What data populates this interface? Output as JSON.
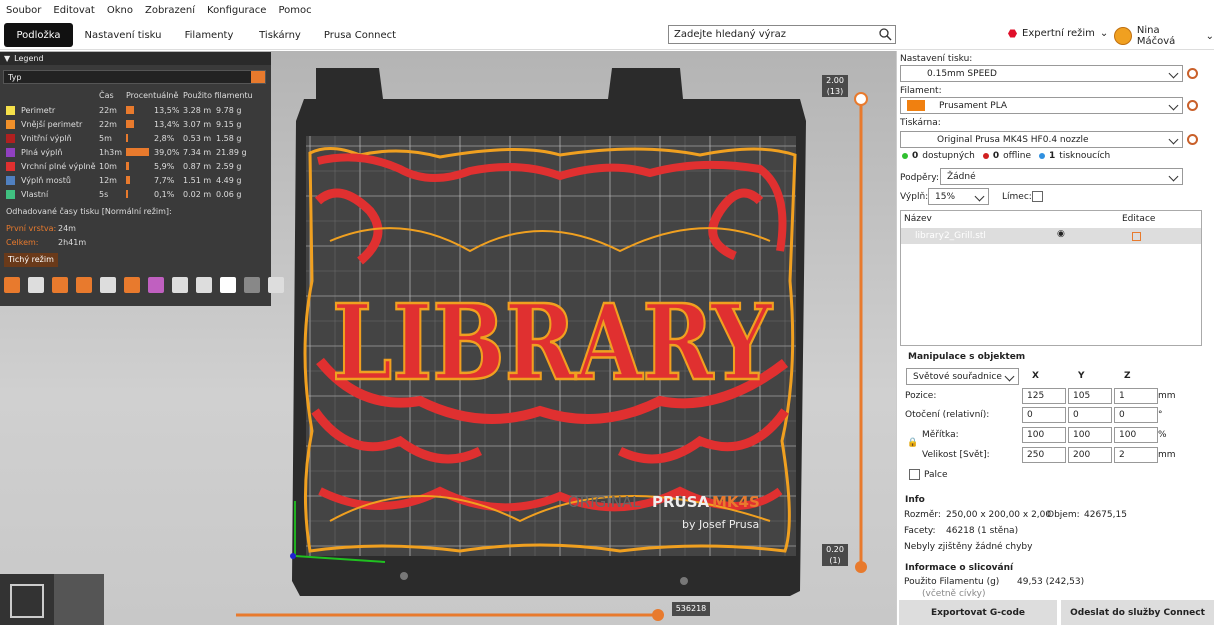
{
  "menu": [
    "Soubor",
    "Editovat",
    "Okno",
    "Zobrazení",
    "Konfigurace",
    "Pomoc"
  ],
  "tabs": [
    "Podložka",
    "Nastavení tisku",
    "Filamenty",
    "Tiskárny",
    "Prusa Connect"
  ],
  "search": {
    "placeholder": "Zadejte hledaný výraz"
  },
  "mode": "Expertní režim",
  "user": "Nina Máčová",
  "legend": {
    "title": "Legend",
    "type": "Typ",
    "headers": [
      "Čas",
      "Procentuálně",
      "Použito filamentu"
    ],
    "rows": [
      {
        "name": "Perimetr",
        "time": "22m",
        "pct": "13,5%",
        "len": "3.28 m",
        "wt": "9.78 g",
        "color": "#f5e04a",
        "frac": 0.135
      },
      {
        "name": "Vnější perimetr",
        "time": "22m",
        "pct": "13,4%",
        "len": "3.07 m",
        "wt": "9.15 g",
        "color": "#f0902a",
        "frac": 0.134
      },
      {
        "name": "Vnitřní výplň",
        "time": "5m",
        "pct": "2,8%",
        "len": "0.53 m",
        "wt": "1.58 g",
        "color": "#b02020",
        "frac": 0.028
      },
      {
        "name": "Plná výplň",
        "time": "1h3m",
        "pct": "39,0%",
        "len": "7.34 m",
        "wt": "21.89 g",
        "color": "#9040c0",
        "frac": 0.39
      },
      {
        "name": "Vrchní plné výplně",
        "time": "10m",
        "pct": "5,9%",
        "len": "0.87 m",
        "wt": "2.59 g",
        "color": "#e03030",
        "frac": 0.059
      },
      {
        "name": "Výplň mostů",
        "time": "12m",
        "pct": "7,7%",
        "len": "1.51 m",
        "wt": "4.49 g",
        "color": "#5080c0",
        "frac": 0.077
      },
      {
        "name": "Vlastní",
        "time": "5s",
        "pct": "0,1%",
        "len": "0.02 m",
        "wt": "0.06 g",
        "color": "#40c080",
        "frac": 0.001
      }
    ],
    "est_title": "Odhadované časy tisku [Normální režim]:",
    "first_layer_label": "První vrstva:",
    "first_layer": "24m",
    "total_label": "Celkem:",
    "total": "2h41m",
    "quiet_btn": "Tichý režim"
  },
  "slider": {
    "top_h": "2.00",
    "top_n": "(13)",
    "bot_h": "0.20",
    "bot_n": "(1)",
    "horiz": "536218"
  },
  "bed_text": {
    "brand1": "ORIGINAL",
    "brand2": "PRUSA",
    "model": "MK4S",
    "by": "by Josef Prusa",
    "logo": "LIBRARY"
  },
  "right": {
    "print_settings_label": "Nastavení tisku:",
    "print_settings": "0.15mm SPEED",
    "filament_label": "Filament:",
    "filament": "Prusament PLA",
    "filament_color": "#f08010",
    "printer_label": "Tiskárna:",
    "printer": "Original Prusa MK4S HF0.4 nozzle",
    "status": {
      "avail": "0",
      "avail_l": "dostupných",
      "off": "0",
      "off_l": "offline",
      "print": "1",
      "print_l": "tisknoucích"
    },
    "supports_label": "Podpěry:",
    "supports": "Žádné",
    "infill_label": "Výplň:",
    "infill": "15%",
    "brim_label": "Límec:",
    "list_name": "Název",
    "list_edit": "Editace",
    "object": "library2_Grill.stl",
    "manip_title": "Manipulace s objektem",
    "coords": "Světové souřadnice",
    "axes": [
      "X",
      "Y",
      "Z"
    ],
    "pos_label": "Pozice:",
    "pos": [
      "125",
      "105",
      "1"
    ],
    "pos_unit": "mm",
    "rot_label": "Otočení (relativní):",
    "rot": [
      "0",
      "0",
      "0"
    ],
    "rot_unit": "°",
    "scale_label": "Měřítka:",
    "scale": [
      "100",
      "100",
      "100"
    ],
    "scale_unit": "%",
    "size_label": "Velikost [Svět]:",
    "size": [
      "250",
      "200",
      "2"
    ],
    "size_unit": "mm",
    "inches": "Palce",
    "info_title": "Info",
    "size_info_l": "Rozměr:",
    "size_info": "250,00 x 200,00 x 2,00",
    "vol_l": "Objem:",
    "vol": "42675,15",
    "facets_l": "Facety:",
    "facets": "46218 (1 stěna)",
    "errors": "Nebyly zjištěny žádné chyby",
    "slice_title": "Informace o slicování",
    "used_l": "Použito Filamentu (g)",
    "used": "49,53 (242,53)",
    "used2": "(včetně cívky)",
    "export": "Exportovat G-code",
    "send": "Odeslat do služby Connect"
  }
}
